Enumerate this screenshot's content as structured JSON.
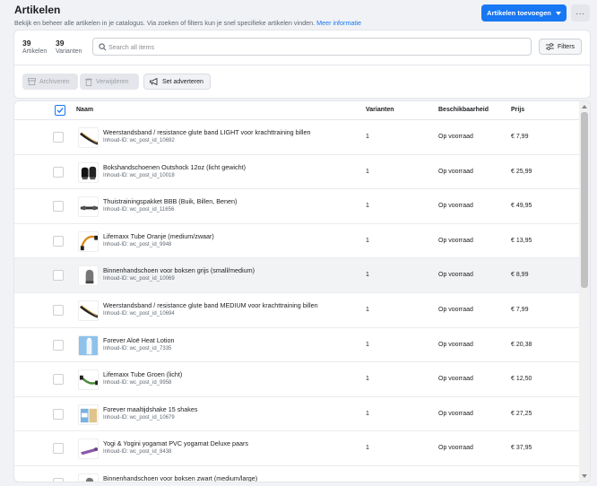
{
  "header": {
    "title": "Artikelen",
    "subtitle": "Bekijk en beheer alle artikelen in je catalogus. Via zoeken of filters kun je snel specifieke artikelen vinden.",
    "info_link": "Meer informatie"
  },
  "actions": {
    "add_label": "Artikelen toevoegen",
    "more_label": "···"
  },
  "stats": [
    {
      "value": "39",
      "label": "Artikelen"
    },
    {
      "value": "39",
      "label": "Varianten"
    }
  ],
  "search": {
    "placeholder": "Search all items"
  },
  "filters_label": "Filters",
  "bulk_actions": {
    "archive": "Archiveren",
    "delete": "Verwijderen",
    "advertise": "Set adverteren"
  },
  "table": {
    "columns": {
      "name": "Naam",
      "variants": "Varianten",
      "availability": "Beschikbaarheid",
      "price": "Prijs"
    },
    "rows": [
      {
        "name": "Weerstandsband / resistance glute band LIGHT voor krachttraining billen",
        "id": "Inhoud-ID: wc_post_id_10692",
        "variants": "1",
        "availability": "Op voorraad",
        "price": "€ 7,99",
        "thumb": "band-dark"
      },
      {
        "name": "Bokshandschoenen Outshock 12oz (licht gewicht)",
        "id": "Inhoud-ID: wc_post_id_10018",
        "variants": "1",
        "availability": "Op voorraad",
        "price": "€ 25,99",
        "thumb": "gloves-black"
      },
      {
        "name": "Thuistrainingspakket BBB (Buik, Billen, Benen)",
        "id": "Inhoud-ID: wc_post_id_11656",
        "variants": "1",
        "availability": "Op voorraad",
        "price": "€ 49,95",
        "thumb": "kit"
      },
      {
        "name": "Lifemaxx Tube Oranje (medium/zwaar)",
        "id": "Inhoud-ID: wc_post_id_9948",
        "variants": "1",
        "availability": "Op voorraad",
        "price": "€ 13,95",
        "thumb": "tube-orange"
      },
      {
        "name": "Binnenhandschoen voor boksen grijs (small/medium)",
        "id": "Inhoud-ID: wc_post_id_10069",
        "variants": "1",
        "availability": "Op voorraad",
        "price": "€ 8,99",
        "thumb": "inner-glove"
      },
      {
        "name": "Weerstandsband / resistance glute band MEDIUM voor krachttraining billen",
        "id": "Inhoud-ID: wc_post_id_10694",
        "variants": "1",
        "availability": "Op voorraad",
        "price": "€ 7,99",
        "thumb": "band-dark"
      },
      {
        "name": "Forever Aloë Heat Lotion",
        "id": "Inhoud-ID: wc_post_id_7335",
        "variants": "1",
        "availability": "Op voorraad",
        "price": "€ 20,38",
        "thumb": "lotion"
      },
      {
        "name": "Lifemaxx Tube Groen (licht)",
        "id": "Inhoud-ID: wc_post_id_9958",
        "variants": "1",
        "availability": "Op voorraad",
        "price": "€ 12,50",
        "thumb": "tube-green"
      },
      {
        "name": "Forever maaltijdshake 15 shakes",
        "id": "Inhoud-ID: wc_post_id_10679",
        "variants": "1",
        "availability": "Op voorraad",
        "price": "€ 27,25",
        "thumb": "shake"
      },
      {
        "name": "Yogi & Yogini yogamat PVC yogamat Deluxe paars",
        "id": "Inhoud-ID: wc_post_id_8438",
        "variants": "1",
        "availability": "Op voorraad",
        "price": "€ 37,95",
        "thumb": "yogamat"
      },
      {
        "name": "Binnenhandschoen voor boksen zwart (medium/large)",
        "id": "",
        "variants": "",
        "availability": "",
        "price": "",
        "thumb": "inner-glove"
      }
    ]
  }
}
